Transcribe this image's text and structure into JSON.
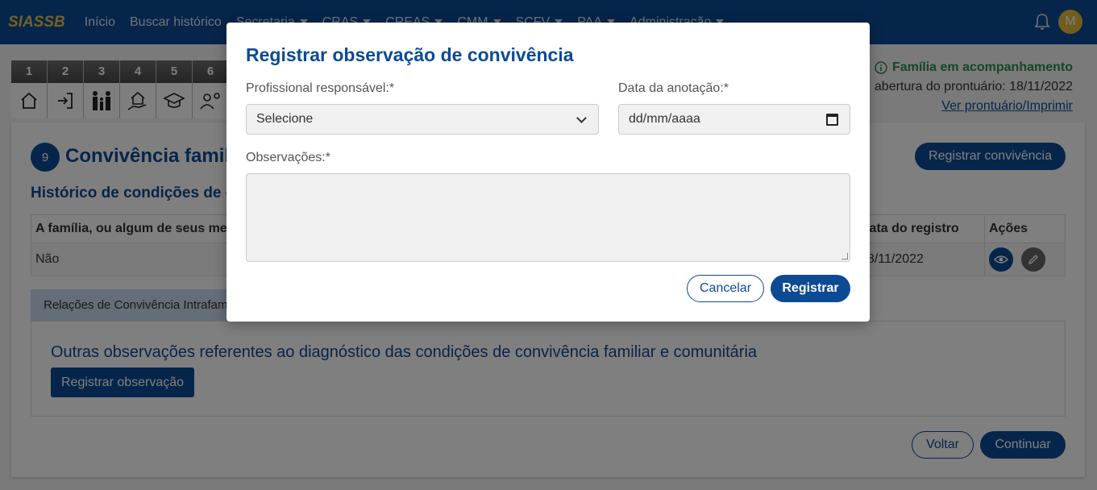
{
  "navbar": {
    "brand": "SIASSB",
    "items": [
      {
        "label": "Início",
        "dropdown": false
      },
      {
        "label": "Buscar histórico",
        "dropdown": false
      },
      {
        "label": "Secretaria",
        "dropdown": true
      },
      {
        "label": "CRAS",
        "dropdown": true
      },
      {
        "label": "CREAS",
        "dropdown": true
      },
      {
        "label": "CMM",
        "dropdown": true
      },
      {
        "label": "SCFV",
        "dropdown": true
      },
      {
        "label": "PAA",
        "dropdown": true
      },
      {
        "label": "Administração",
        "dropdown": true
      }
    ],
    "notifications_icon": "bell-icon",
    "avatar_initial": "M"
  },
  "steps": [
    {
      "num": "1",
      "icon": "home-icon"
    },
    {
      "num": "2",
      "icon": "login-icon"
    },
    {
      "num": "3",
      "icon": "family-icon"
    },
    {
      "num": "4",
      "icon": "house-hand-icon"
    },
    {
      "num": "5",
      "icon": "graduation-cap-icon"
    },
    {
      "num": "6",
      "icon": "user-gear-icon"
    }
  ],
  "status": {
    "text": "Família em acompanhamento",
    "open_date": "abertura do prontuário: 18/11/2022",
    "print_link": "Ver prontuário/Imprimir"
  },
  "section": {
    "number": "9",
    "title": "Convivência familiar e comunitária",
    "register_button": "Registrar convivência",
    "history_title": "Histórico de condições de convivência",
    "table": {
      "headers": [
        "A família, ou algum de seus membros",
        "Data do registro",
        "Ações"
      ],
      "rows": [
        {
          "value": "Não",
          "date": "18/11/2022"
        }
      ]
    },
    "tab_label": "Relações de Convivência Intrafamiliar",
    "other_obs_title": "Outras observações referentes ao diagnóstico das condições de convivência familiar e comunitária",
    "register_obs_button": "Registrar observação",
    "back_button": "Voltar",
    "continue_button": "Continuar"
  },
  "modal": {
    "title": "Registrar observação de convivência",
    "professional_label": "Profissional responsável:*",
    "professional_value": "Selecione",
    "date_label": "Data da anotação:*",
    "date_placeholder": "dd/mm/aaaa",
    "observations_label": "Observações:*",
    "cancel_button": "Cancelar",
    "register_button": "Registrar"
  },
  "colors": {
    "primary": "#0d4a94",
    "brand": "#e8c24a",
    "status_green": "#2e8a4e",
    "tab_bg": "#c8daf0"
  }
}
